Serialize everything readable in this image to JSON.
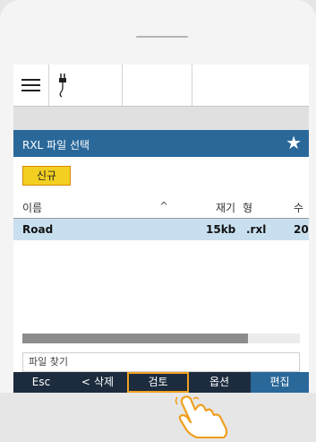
{
  "dialog": {
    "title": "RXL 파일 선택"
  },
  "buttons": {
    "new": "신규"
  },
  "columns": [
    {
      "label": "이름",
      "sort": "^"
    },
    {
      "label": "재기"
    },
    {
      "label": "형"
    },
    {
      "label": "수"
    }
  ],
  "rows": [
    {
      "name": "Road",
      "size": "15kb",
      "type": ".rxl",
      "count": "20"
    }
  ],
  "find_placeholder": "파일 찾기",
  "bottom_bar": {
    "esc": "Esc",
    "back": "<",
    "delete": "삭제",
    "review": "검토",
    "options": "옵션",
    "edit": "편집"
  },
  "colors": {
    "accent": "#2a689a",
    "selected_row": "#c8dfef",
    "new_button": "#f2cf21",
    "bottom_bar": "#1c2c3e",
    "highlight": "#f0a020"
  },
  "icons": [
    "menu-icon",
    "plug-icon",
    "star-icon",
    "hand-pointer-icon"
  ]
}
